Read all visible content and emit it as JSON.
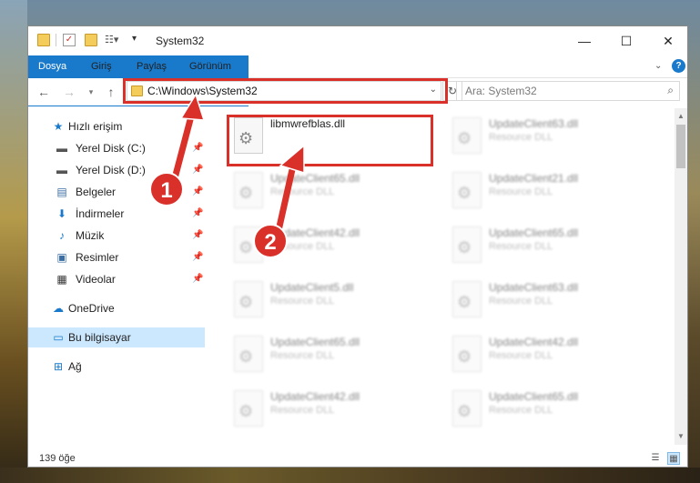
{
  "window": {
    "title": "System32"
  },
  "ribbon": {
    "tabs": [
      "Dosya",
      "Giriş",
      "Paylaş",
      "Görünüm"
    ]
  },
  "address": {
    "path": "C:\\Windows\\System32"
  },
  "search": {
    "placeholder": "Ara: System32"
  },
  "sidebar": {
    "items": [
      {
        "label": "Hızlı erişim",
        "icon": "star-icon"
      },
      {
        "label": "Yerel Disk (C:)",
        "icon": "drive-icon"
      },
      {
        "label": "Yerel Disk (D:)",
        "icon": "drive-icon"
      },
      {
        "label": "Belgeler",
        "icon": "documents-icon"
      },
      {
        "label": "İndirmeler",
        "icon": "download-icon"
      },
      {
        "label": "Müzik",
        "icon": "music-icon"
      },
      {
        "label": "Resimler",
        "icon": "pictures-icon"
      },
      {
        "label": "Videolar",
        "icon": "videos-icon"
      },
      {
        "label": "OneDrive",
        "icon": "cloud-icon"
      },
      {
        "label": "Bu bilgisayar",
        "icon": "computer-icon"
      },
      {
        "label": "Ağ",
        "icon": "network-icon"
      }
    ]
  },
  "files": [
    {
      "name": "libmwrefblas.dll",
      "type": ""
    },
    {
      "name": "UpdateClient63.dll",
      "type": "Resource DLL"
    },
    {
      "name": "UpdateClient65.dll",
      "type": "Resource DLL"
    },
    {
      "name": "UpdateClient21.dll",
      "type": "Resource DLL"
    },
    {
      "name": "UpdateClient42.dll",
      "type": "Resource DLL"
    },
    {
      "name": "UpdateClient65.dll",
      "type": "Resource DLL"
    },
    {
      "name": "UpdateClient5.dll",
      "type": "Resource DLL"
    },
    {
      "name": "UpdateClient63.dll",
      "type": "Resource DLL"
    },
    {
      "name": "UpdateClient65.dll",
      "type": "Resource DLL"
    },
    {
      "name": "UpdateClient42.dll",
      "type": "Resource DLL"
    },
    {
      "name": "UpdateClient42.dll",
      "type": "Resource DLL"
    },
    {
      "name": "UpdateClient65.dll",
      "type": "Resource DLL"
    }
  ],
  "status": {
    "item_count": "139 öğe"
  },
  "callouts": [
    "1",
    "2"
  ],
  "colors": {
    "accent": "#1979ca",
    "highlight": "#d9302a",
    "selected": "#cce8ff"
  }
}
